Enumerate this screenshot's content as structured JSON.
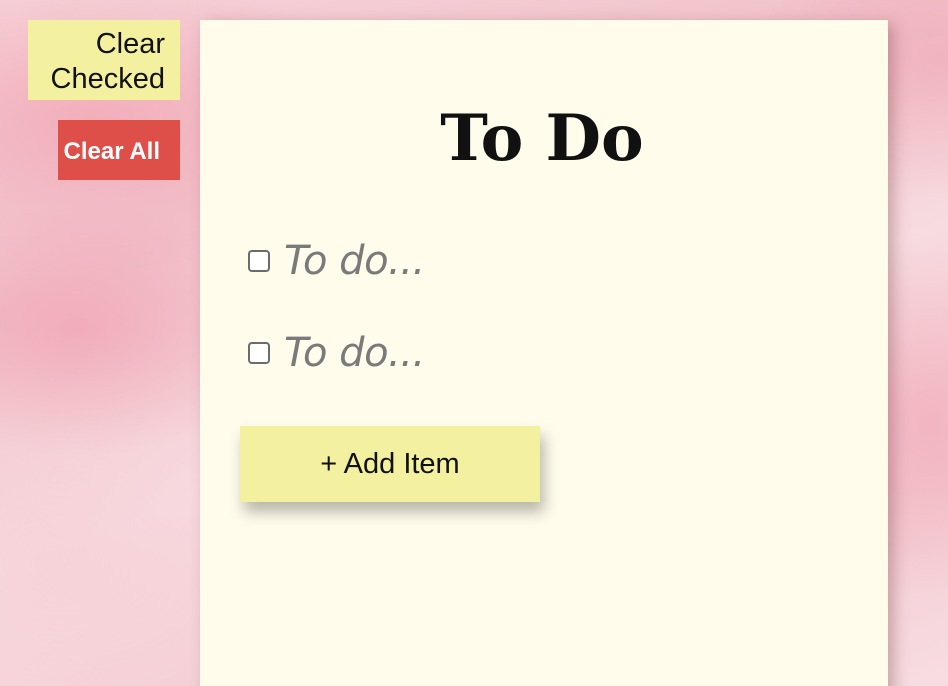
{
  "sidebar": {
    "clear_checked_label": "Clear Checked",
    "clear_all_label": "Clear All"
  },
  "note": {
    "title": "To Do",
    "items": [
      {
        "placeholder": "To do...",
        "checked": false
      },
      {
        "placeholder": "To do...",
        "checked": false
      }
    ],
    "add_item_label": "+ Add Item"
  },
  "colors": {
    "note_background": "#fffcec",
    "yellow_button": "#f3f0a0",
    "red_button": "#df4f49",
    "page_background": "#f4ccd3"
  }
}
